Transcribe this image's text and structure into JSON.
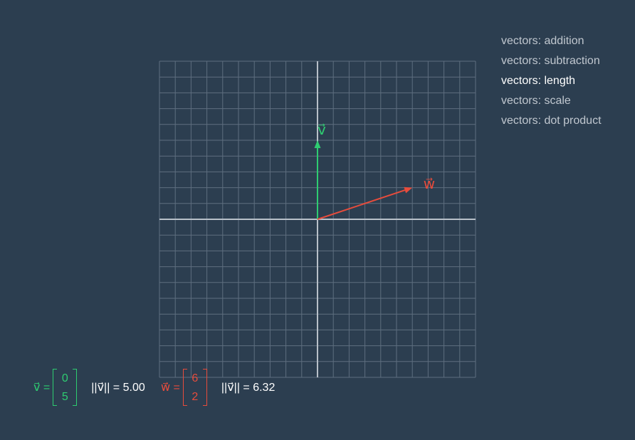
{
  "menu": [
    {
      "label": "vectors: addition",
      "active": false
    },
    {
      "label": "vectors: subtraction",
      "active": false
    },
    {
      "label": "vectors: length",
      "active": true
    },
    {
      "label": "vectors: scale",
      "active": false
    },
    {
      "label": "vectors: dot product",
      "active": false
    }
  ],
  "grid": {
    "x_range": [
      -10,
      10
    ],
    "y_range": [
      -10,
      10
    ],
    "grid_lines": true
  },
  "colors": {
    "background": "#2c3e50",
    "grid": "#5e6e7f",
    "axis": "#b8c0c9",
    "v": "#2ecc71",
    "w": "#e74c3c"
  },
  "vectors": {
    "v": {
      "label": "v⃗",
      "components": [
        0,
        5
      ],
      "x_label": "0",
      "y_label": "5",
      "prefix": "v⃗ =",
      "norm_text": "||v⃗|| = 5.00"
    },
    "w": {
      "label": "w⃗",
      "components": [
        6,
        2
      ],
      "x_label": "6",
      "y_label": "2",
      "prefix": "w⃗ =",
      "norm_text": "||v⃗|| = 6.32"
    }
  }
}
